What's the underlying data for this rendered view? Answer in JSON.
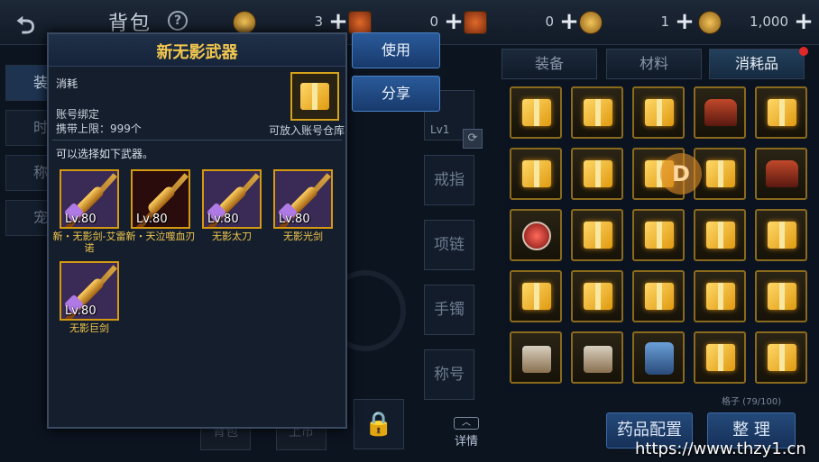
{
  "header": {
    "title": "背包",
    "help": "?",
    "currencies": [
      {
        "icon": "gold-coin-icon",
        "value": "3"
      },
      {
        "icon": "scroll-icon",
        "value": "0"
      },
      {
        "icon": "ticket-icon",
        "value": "0"
      },
      {
        "icon": "bronze-coin-icon",
        "value": "1"
      },
      {
        "icon": "gold-ingot-icon",
        "value": "1,000"
      }
    ],
    "plus": "+"
  },
  "inventory_tabs": [
    {
      "label": "装备",
      "active": false
    },
    {
      "label": "材料",
      "active": false
    },
    {
      "label": "消耗品",
      "active": true
    }
  ],
  "left_tabs": [
    "装",
    "时",
    "称",
    "宠"
  ],
  "equip_slots": {
    "top_level": "Lv1",
    "slots": [
      "戒指",
      "项链",
      "手镯",
      "称号"
    ]
  },
  "capacity": "格子 (79/100)",
  "bottom": {
    "detail": "详情",
    "potion_config": "药品配置",
    "sort": "整 理",
    "ghost_left": "背包",
    "ghost_right": "上市"
  },
  "popup": {
    "title": "新无影武器",
    "type": "消耗",
    "bind": "账号绑定",
    "limit": "携带上限：999个",
    "store": "可放入账号仓库",
    "choose": "可以选择如下武器。",
    "weapons": [
      {
        "lv": "Lv.80",
        "name": "新・无影剑-艾雷诺"
      },
      {
        "lv": "Lv.80",
        "name": "新・天泣噬血刃"
      },
      {
        "lv": "Lv.80",
        "name": "无影太刀"
      },
      {
        "lv": "Lv.80",
        "name": "无影光剑"
      },
      {
        "lv": "Lv.80",
        "name": "无影巨剑"
      }
    ]
  },
  "actions": {
    "use": "使用",
    "share": "分享"
  },
  "overlay": {
    "d_mark": "D",
    "watermark": "https://www.thzy1.cn"
  },
  "colors": {
    "title_gold": "#f2c74e",
    "button_blue": "#2a5a9a",
    "item_border": "#d69a10"
  }
}
